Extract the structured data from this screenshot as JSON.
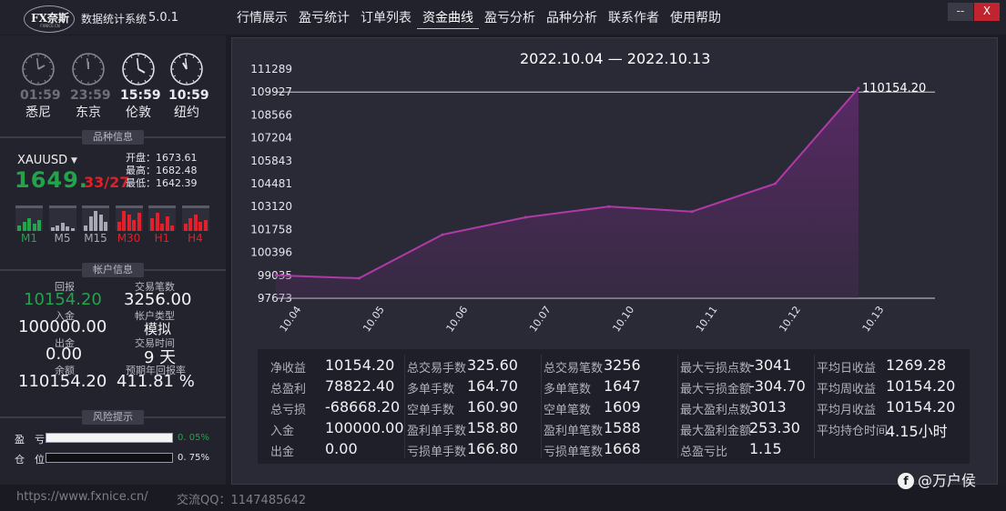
{
  "app": {
    "logo_text": "FX奈斯",
    "logo_sub": "FXNICE.CN",
    "name": "数据统计系统",
    "version": "5.0.1",
    "menu": [
      {
        "label": "行情展示"
      },
      {
        "label": "盈亏统计"
      },
      {
        "label": "订单列表"
      },
      {
        "label": "资金曲线",
        "active": true
      },
      {
        "label": "盈亏分析"
      },
      {
        "label": "品种分析"
      },
      {
        "label": "联系作者"
      },
      {
        "label": "使用帮助"
      }
    ],
    "minimize_label": "--",
    "close_label": "X"
  },
  "clocks": [
    {
      "time": "01:59",
      "city": "悉尼",
      "hour": 1,
      "minute": 59,
      "lit": false
    },
    {
      "time": "23:59",
      "city": "东京",
      "hour": 23,
      "minute": 59,
      "lit": false
    },
    {
      "time": "15:59",
      "city": "伦敦",
      "hour": 15,
      "minute": 59,
      "lit": true
    },
    {
      "time": "10:59",
      "city": "纽约",
      "hour": 10,
      "minute": 59,
      "lit": true
    }
  ],
  "symbol_section": {
    "title": "品种信息",
    "symbol": "XAUUSD",
    "price_main": "1649.",
    "price_red": "33/27",
    "open": "开盘：1673.61",
    "high": "最高：1682.48",
    "low": "最低：1642.39",
    "timeframes": [
      {
        "label": "M1",
        "color": "#21a44a"
      },
      {
        "label": "M5",
        "color": "#a8a8b4"
      },
      {
        "label": "M15",
        "color": "#a8a8b4"
      },
      {
        "label": "M30",
        "color": "#e0202a"
      },
      {
        "label": "H1",
        "color": "#e0202a"
      },
      {
        "label": "H4",
        "color": "#e0202a"
      }
    ]
  },
  "account_section": {
    "title": "帐户信息",
    "return_label": "回报",
    "return_value": "10154.20",
    "trades_label": "交易笔数",
    "trades_value": "3256.00",
    "deposit_label": "入金",
    "deposit_value": "100000.00",
    "type_label": "帐户类型",
    "type_value": "模拟",
    "withdraw_label": "出金",
    "withdraw_value": "0.00",
    "time_label": "交易时间",
    "time_value": "9 天",
    "balance_label": "余额",
    "balance_value": "110154.20",
    "annual_label": "预期年回报率",
    "annual_value": "411.81 %"
  },
  "risk_section": {
    "title": "风险提示",
    "rows": [
      {
        "label": "盈　亏",
        "pct_text": "0. 05%",
        "fill": 1.0,
        "color": "#21a44a"
      },
      {
        "label": "仓　位",
        "pct_text": "0. 75%",
        "fill": 0.0,
        "color": "#e6e6ee"
      }
    ]
  },
  "chart_data": {
    "type": "area",
    "title": "2022.10.04 — 2022.10.13",
    "categories": [
      "10.04",
      "10.05",
      "10.06",
      "10.07",
      "10.10",
      "10.11",
      "10.12",
      "10.13"
    ],
    "values": [
      99035,
      98860,
      101450,
      102480,
      103120,
      102820,
      104481,
      110154.2
    ],
    "yticks": [
      "111289",
      "109927",
      "108566",
      "107204",
      "105843",
      "104481",
      "103120",
      "101758",
      "100396",
      "99035",
      "97673"
    ],
    "ylim": [
      97673,
      111289
    ],
    "last_label": "110154.20",
    "line_color": "#b03aa8",
    "fill_color": "#5a2a66"
  },
  "stats": {
    "columns": [
      [
        {
          "k": "净收益",
          "v": "10154.20"
        },
        {
          "k": "总盈利",
          "v": "78822.40"
        },
        {
          "k": "总亏损",
          "v": "-68668.20"
        },
        {
          "k": "入金",
          "v": "100000.00"
        },
        {
          "k": "出金",
          "v": "0.00"
        }
      ],
      [
        {
          "k": "总交易手数",
          "v": "325.60"
        },
        {
          "k": "多单手数",
          "v": "164.70"
        },
        {
          "k": "空单手数",
          "v": "160.90"
        },
        {
          "k": "盈利单手数",
          "v": "158.80"
        },
        {
          "k": "亏损单手数",
          "v": "166.80"
        }
      ],
      [
        {
          "k": "总交易笔数",
          "v": "3256"
        },
        {
          "k": "多单笔数",
          "v": "1647"
        },
        {
          "k": "空单笔数",
          "v": "1609"
        },
        {
          "k": "盈利单笔数",
          "v": "1588"
        },
        {
          "k": "亏损单笔数",
          "v": "1668"
        }
      ],
      [
        {
          "k": "最大亏损点数",
          "v": "-3041"
        },
        {
          "k": "最大亏损金额",
          "v": "-304.70"
        },
        {
          "k": "最大盈利点数",
          "v": "3013"
        },
        {
          "k": "最大盈利金额",
          "v": "253.30"
        },
        {
          "k": "总盈亏比",
          "v": "1.15"
        }
      ],
      [
        {
          "k": "平均日收益",
          "v": "1269.28"
        },
        {
          "k": "平均周收益",
          "v": "10154.20"
        },
        {
          "k": "平均月收益",
          "v": "10154.20"
        },
        {
          "k": "平均持仓时间",
          "v": "4.15小时"
        }
      ]
    ]
  },
  "footer": {
    "url": "https://www.fxnice.cn/",
    "qq": "交流QQ：1147485642",
    "watermark": "@万户侯",
    "watermark_icon": "f"
  }
}
